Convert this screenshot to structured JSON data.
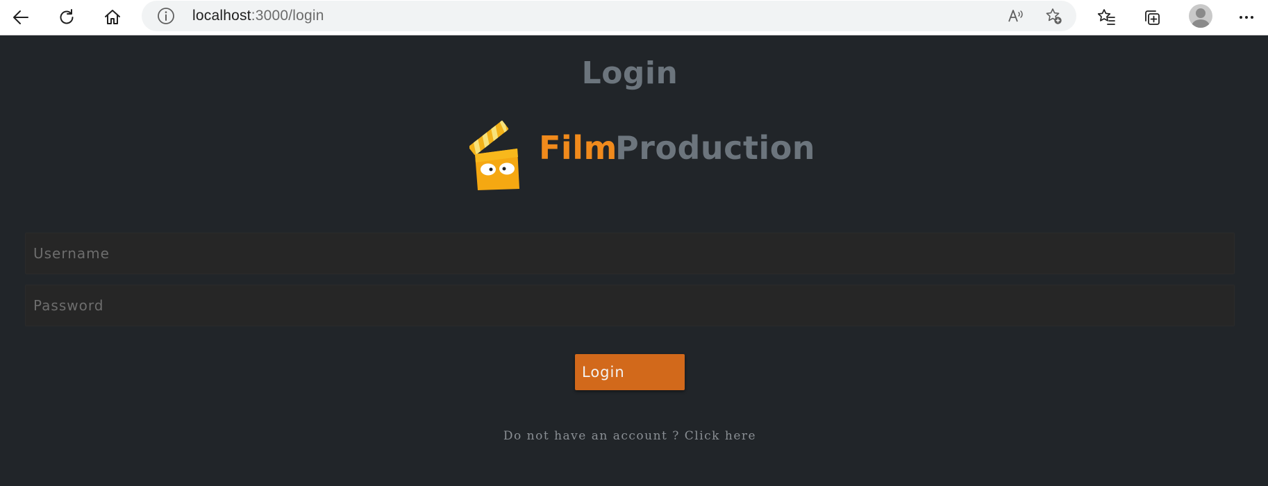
{
  "browser": {
    "url_host": "localhost",
    "url_path": ":3000/login"
  },
  "page": {
    "title": "Login",
    "logo": {
      "word_1": "Film",
      "word_2": "Production",
      "accent_color": "#f08a1c",
      "muted_color": "#6c757d"
    },
    "form": {
      "username_placeholder": "Username",
      "username_value": "",
      "password_placeholder": "Password",
      "password_value": "",
      "submit_label": "Login"
    },
    "signup_text": "Do not have an account ? Click here"
  },
  "theme": {
    "background": "#212529",
    "button": "#d2691b"
  }
}
